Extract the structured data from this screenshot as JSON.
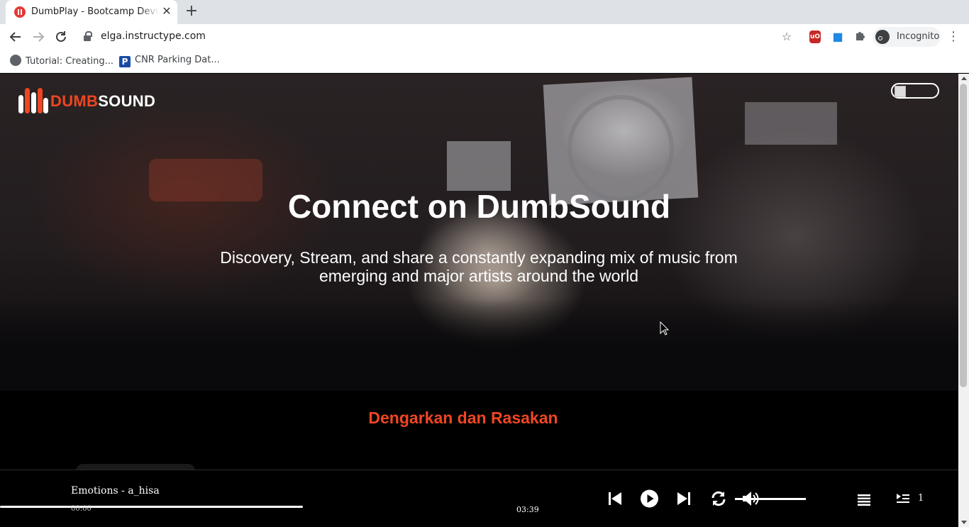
{
  "browser": {
    "tab_title": "DumbPlay - Bootcamp DevOps",
    "new_tab_icon": "plus-icon",
    "url": "elga.instructype.com",
    "profile_label": "Incognito",
    "bookmarks": [
      {
        "label": "Tutorial: Creating...",
        "icon": "globe-icon"
      },
      {
        "label": "CNR Parking Dat...",
        "icon": "parking-icon"
      }
    ]
  },
  "site": {
    "logo": {
      "word1": "DUMB",
      "word2": "SOUND"
    },
    "colors": {
      "accent": "#ee4622"
    },
    "hero": {
      "title": "Connect on DumbSound",
      "subtitle": "Discovery, Stream, and share a constantly expanding mix of music from emerging and major artists around the world"
    },
    "section_title": "Dengarkan dan Rasakan"
  },
  "player": {
    "song": "Emotions - a_hisa",
    "current_time": "00:00",
    "total_time": "03:39",
    "progress_fraction": 0.0,
    "volume_fraction": 1.0,
    "queue_count": "1"
  }
}
